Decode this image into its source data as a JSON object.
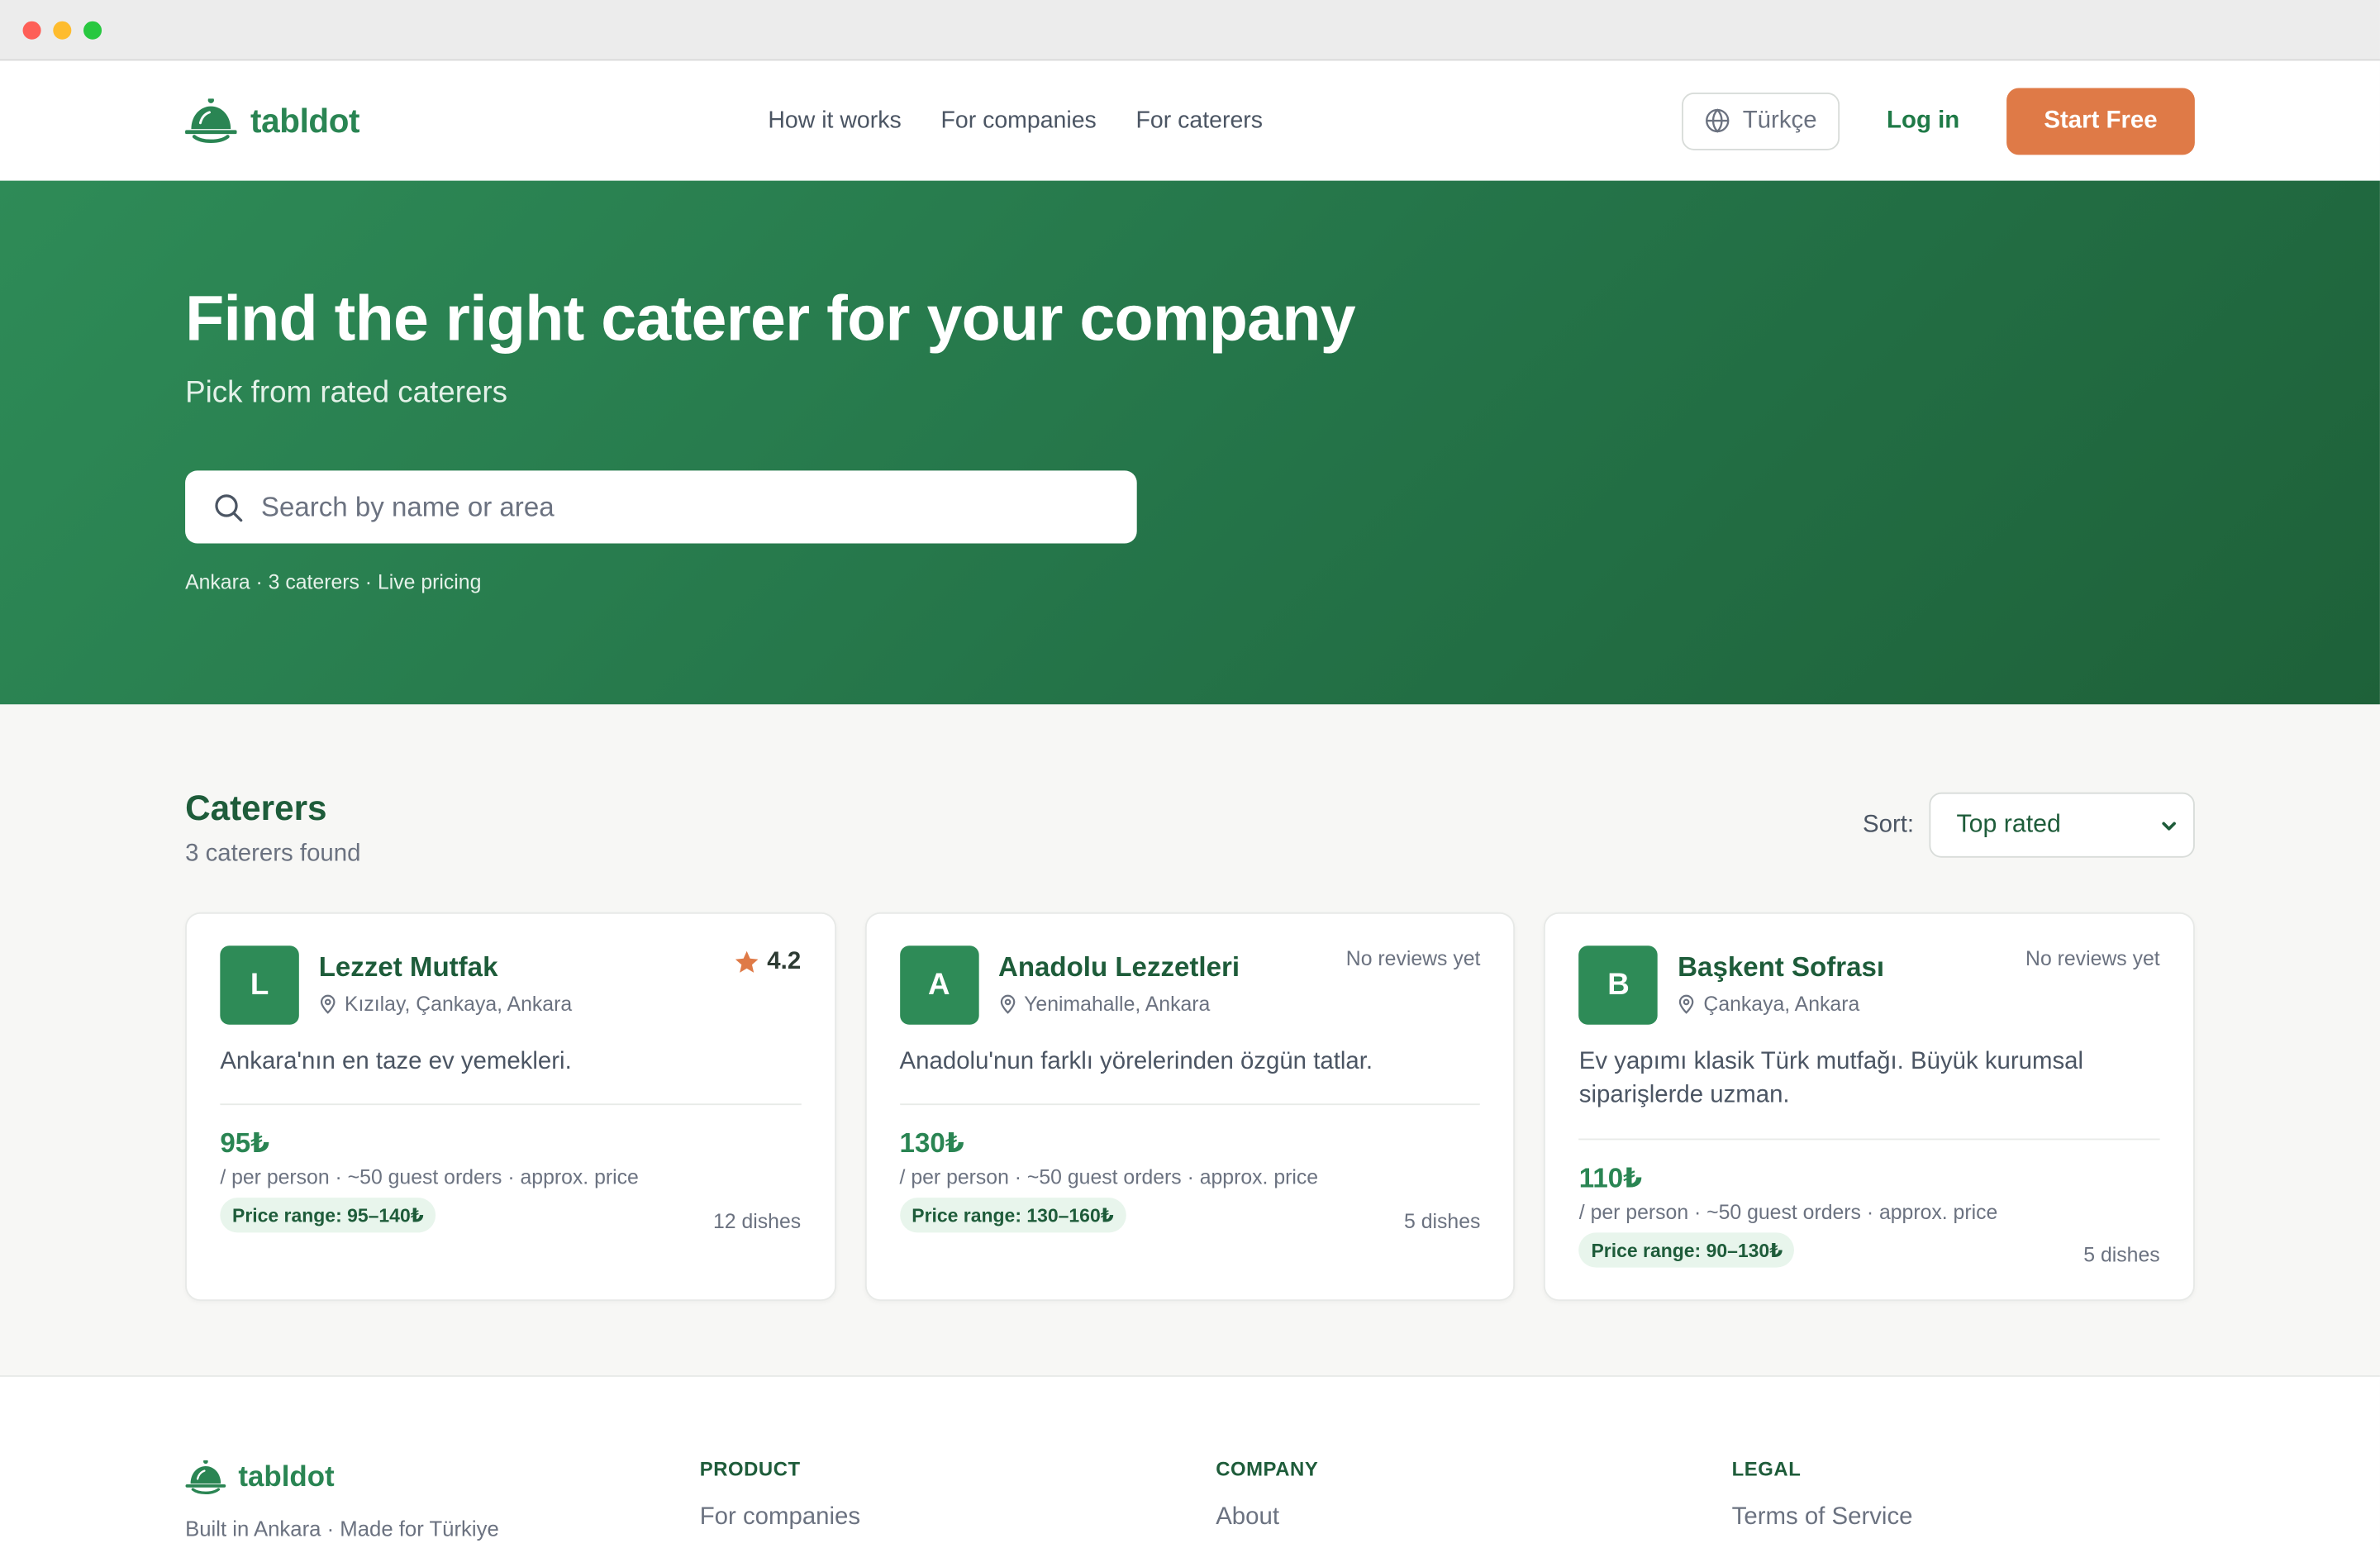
{
  "brand": {
    "name": "tabldot",
    "color": "#2a8553",
    "accent": "#df7a47"
  },
  "header": {
    "nav": [
      "How it works",
      "For companies",
      "For caterers"
    ],
    "language": "Türkçe",
    "login": "Log in",
    "cta": "Start Free"
  },
  "hero": {
    "title": "Find the right caterer for your company",
    "subtitle": "Pick from rated caterers",
    "search_placeholder": "Search by name or area",
    "meta": "Ankara · 3 caterers · Live pricing"
  },
  "listing": {
    "title": "Caterers",
    "count": "3 caterers found",
    "sort_label": "Sort:",
    "sort_value": "Top rated"
  },
  "caterers": [
    {
      "initial": "L",
      "name": "Lezzet Mutfak",
      "location": "Kızılay, Çankaya, Ankara",
      "rating": "4.2",
      "reviews": "",
      "description": "Ankara'nın en taze ev yemekleri.",
      "price": "95₺",
      "price_note": "/ per person · ~50 guest orders · approx. price",
      "range": "Price range: 95–140₺",
      "dishes": "12 dishes"
    },
    {
      "initial": "A",
      "name": "Anadolu Lezzetleri",
      "location": "Yenimahalle, Ankara",
      "rating": "",
      "reviews": "No reviews yet",
      "description": "Anadolu'nun farklı yörelerinden özgün tatlar.",
      "price": "130₺",
      "price_note": "/ per person · ~50 guest orders · approx. price",
      "range": "Price range: 130–160₺",
      "dishes": "5 dishes"
    },
    {
      "initial": "B",
      "name": "Başkent Sofrası",
      "location": "Çankaya, Ankara",
      "rating": "",
      "reviews": "No reviews yet",
      "description": "Ev yapımı klasik Türk mutfağı. Büyük kurumsal siparişlerde uzman.",
      "price": "110₺",
      "price_note": "/ per person · ~50 guest orders · approx. price",
      "range": "Price range: 90–130₺",
      "dishes": "5 dishes"
    }
  ],
  "footer": {
    "tagline": "Built in Ankara · Made for Türkiye",
    "columns": [
      {
        "title": "PRODUCT",
        "first_link": "For companies"
      },
      {
        "title": "COMPANY",
        "first_link": "About"
      },
      {
        "title": "LEGAL",
        "first_link": "Terms of Service"
      }
    ]
  }
}
